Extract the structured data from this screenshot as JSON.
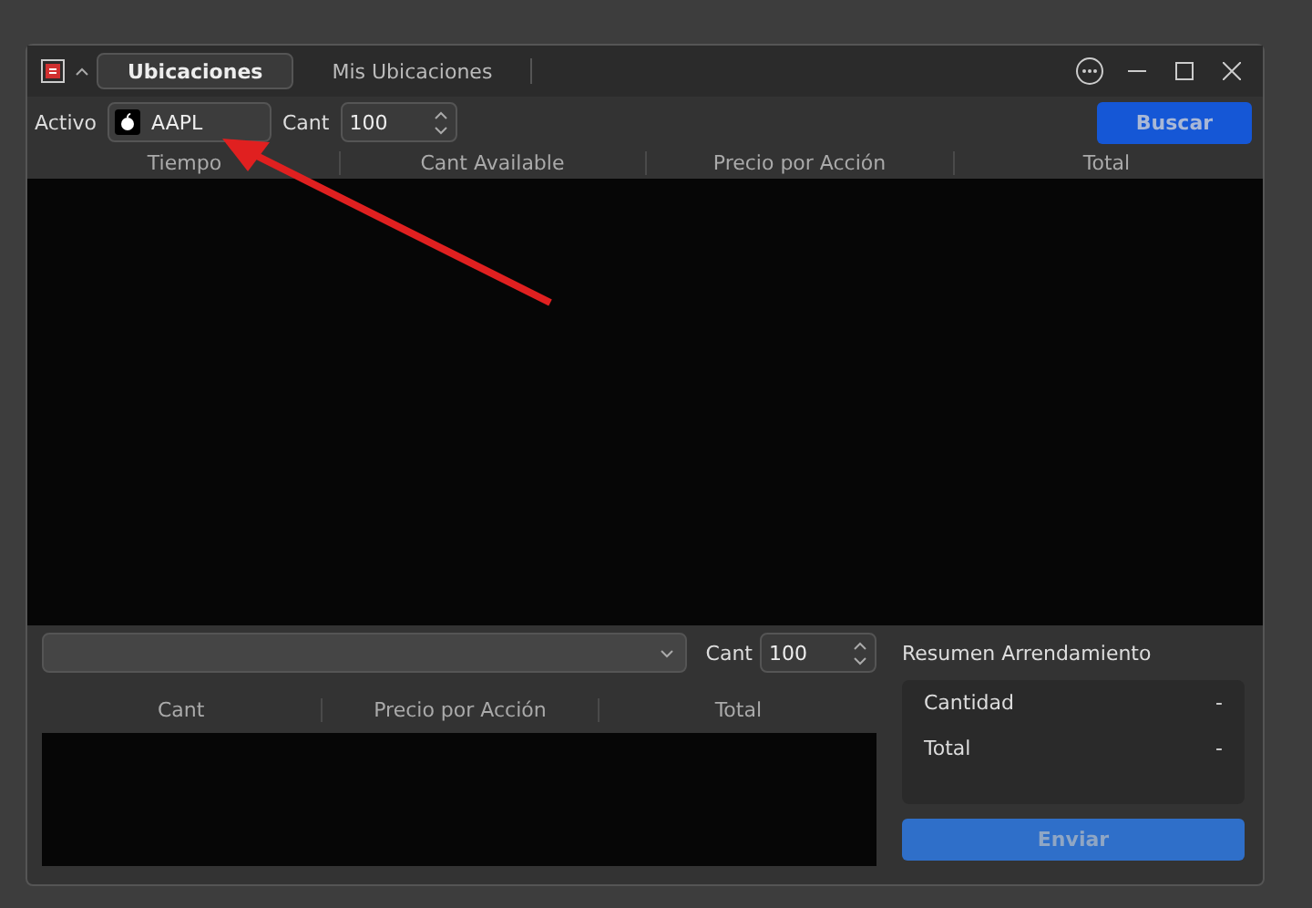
{
  "tabs": [
    {
      "label": "Ubicaciones",
      "selected": true
    },
    {
      "label": "Mis Ubicaciones",
      "selected": false
    }
  ],
  "toolbar": {
    "asset_label": "Activo",
    "asset": "AAPL",
    "qty_label": "Cant",
    "qty": "100",
    "search_button": "Buscar"
  },
  "table": {
    "columns": [
      "Tiempo",
      "Cant Available",
      "Precio por Acción",
      "Total"
    ]
  },
  "order": {
    "qty_label": "Cant",
    "qty": "100",
    "columns": [
      "Cant",
      "Precio por Acción",
      "Total"
    ]
  },
  "summary": {
    "title": "Resumen Arrendamiento",
    "rows": [
      {
        "label": "Cantidad",
        "value": "-"
      },
      {
        "label": "Total",
        "value": "-"
      }
    ],
    "submit_button": "Enviar"
  }
}
